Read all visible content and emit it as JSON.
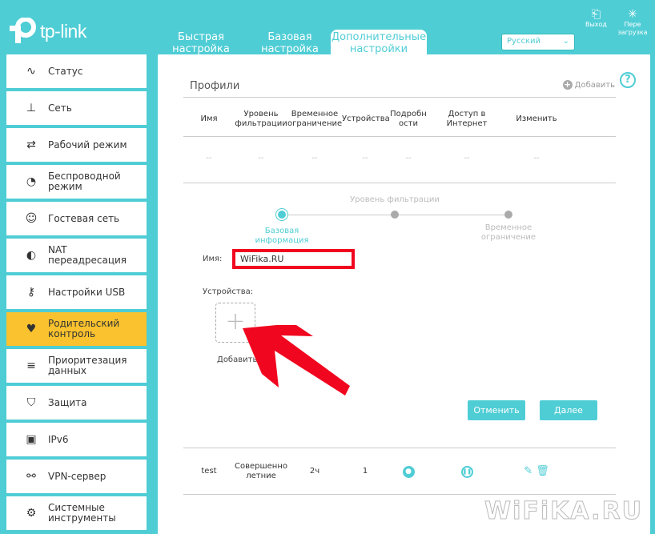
{
  "brand": "tp-link",
  "tabs": [
    {
      "label": "Быстрая настройка"
    },
    {
      "label": "Базовая настройка"
    },
    {
      "label": "Дополнительные настройки"
    }
  ],
  "language": "Русский",
  "top_buttons": {
    "logout": "Выход",
    "reboot": "Пере загрузка"
  },
  "sidebar": [
    {
      "label": "Статус",
      "icon": "pulse-icon"
    },
    {
      "label": "Сеть",
      "icon": "network-icon"
    },
    {
      "label": "Рабочий режим",
      "icon": "mode-icon"
    },
    {
      "label": "Беспроводной режим",
      "icon": "wireless-icon"
    },
    {
      "label": "Гостевая сеть",
      "icon": "guest-icon"
    },
    {
      "label": "NAT переадресация",
      "icon": "nat-icon"
    },
    {
      "label": "Настройки USB",
      "icon": "usb-icon"
    },
    {
      "label": "Родительский контроль",
      "icon": "parental-icon"
    },
    {
      "label": "Приоритезация данных",
      "icon": "qos-icon"
    },
    {
      "label": "Защита",
      "icon": "shield-icon"
    },
    {
      "label": "IPv6",
      "icon": "ipv6-icon"
    },
    {
      "label": "VPN-сервер",
      "icon": "vpn-icon"
    },
    {
      "label": "Системные инструменты",
      "icon": "tools-icon"
    }
  ],
  "profiles": {
    "title": "Профили",
    "add": "Добавить",
    "columns": [
      "Имя",
      "Уровень фильтрации",
      "Временное ограничение",
      "Устройства",
      "Подробности",
      "Доступ в Интернет",
      "Изменить"
    ],
    "empty": [
      "--",
      "--",
      "--",
      "--",
      "--",
      "--",
      "--"
    ],
    "rows": [
      {
        "name": "test",
        "level": "Совершеннолетние",
        "time": "2ч",
        "devices": "1"
      }
    ]
  },
  "wizard": {
    "steps": [
      "Базовая информация",
      "Уровень фильтрации",
      "Временное ограничение"
    ],
    "name_label": "Имя:",
    "name_value": "WiFika.RU",
    "devices_label": "Устройства:",
    "add_device": "Добавить",
    "cancel": "Отменить",
    "next": "Далее"
  },
  "watermark": "WiFiKA.RU",
  "accent": "#4fcdd5"
}
